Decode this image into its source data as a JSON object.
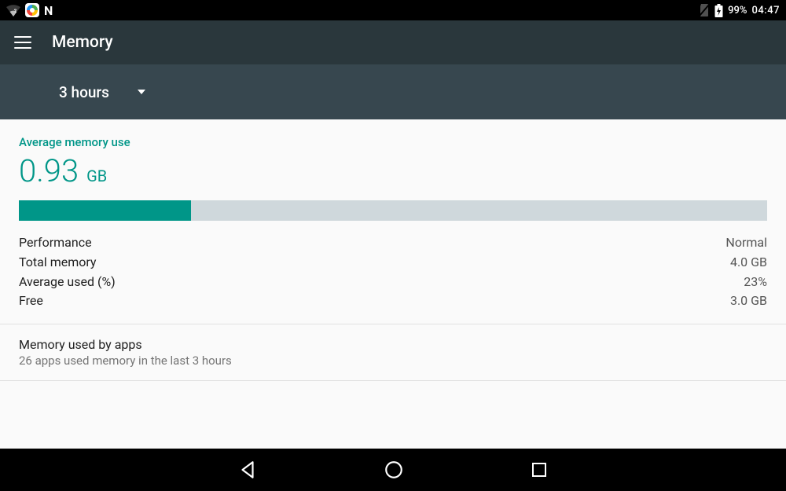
{
  "status": {
    "battery_pct": "99%",
    "clock": "04:47"
  },
  "appbar": {
    "title": "Memory"
  },
  "dropdown": {
    "selected": "3 hours"
  },
  "memory": {
    "heading": "Average memory use",
    "value_num": "0.93",
    "value_unit": "GB",
    "used_pct_bar": 23,
    "stats": [
      {
        "label": "Performance",
        "value": "Normal"
      },
      {
        "label": "Total memory",
        "value": "4.0 GB"
      },
      {
        "label": "Average used (%)",
        "value": "23%"
      },
      {
        "label": "Free",
        "value": "3.0 GB"
      }
    ]
  },
  "apps_section": {
    "title": "Memory used by apps",
    "subtitle": "26 apps used memory in the last 3 hours"
  }
}
